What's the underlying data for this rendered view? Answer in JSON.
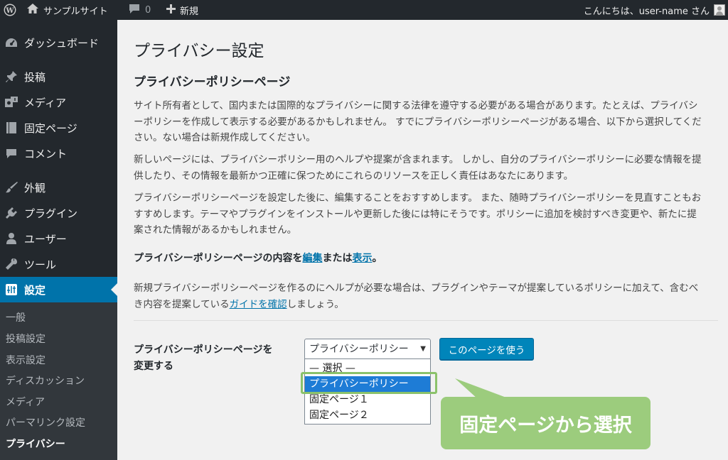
{
  "admin_bar": {
    "site_name": "サンプルサイト",
    "comment_count": "0",
    "new_label": "新規",
    "greeting": "こんにちは、user-name さん"
  },
  "sidebar": {
    "items": [
      {
        "label": "ダッシュボード",
        "icon": "dashboard-icon"
      },
      {
        "label": "投稿",
        "icon": "pin-icon"
      },
      {
        "label": "メディア",
        "icon": "media-icon"
      },
      {
        "label": "固定ページ",
        "icon": "page-icon"
      },
      {
        "label": "コメント",
        "icon": "comment-icon"
      },
      {
        "label": "外観",
        "icon": "appearance-icon"
      },
      {
        "label": "プラグイン",
        "icon": "plugin-icon"
      },
      {
        "label": "ユーザー",
        "icon": "user-icon"
      },
      {
        "label": "ツール",
        "icon": "wrench-icon"
      },
      {
        "label": "設定",
        "icon": "settings-icon"
      }
    ],
    "submenu": [
      "一般",
      "投稿設定",
      "表示設定",
      "ディスカッション",
      "メディア",
      "パーマリンク設定",
      "プライバシー"
    ]
  },
  "main": {
    "page_title": "プライバシー設定",
    "section_title": "プライバシーポリシーページ",
    "para1": [
      "サイト所有者として、国内または国際的なプライバシーに関する法律を遵守する必要がある場合があります。たとえば、プライバシ",
      "ーポリシーを作成して表示する必要があるかもしれません。 すでにプライバシーポリシーページがある場合、以下から選択してくだ",
      "さい。ない場合は新規作成してください。"
    ],
    "para2": [
      "新しいページには、プライバシーポリシー用のヘルプや提案が含まれます。 しかし、自分のプライバシーポリシーに必要な情報を提",
      "供したり、その情報を最新かつ正確に保つためにこれらのリソースを正しく責任はあなたにあります。"
    ],
    "para3": [
      "プライバシーポリシーページを設定した後に、編集することをおすすめします。 また、随時プライバシーポリシーを見直すこともお",
      "すすめします。テーマやプラグインをインストールや更新した後には特にそうです。ポリシーに追加を検討すべき変更や、新たに提",
      "案された情報があるかもしれません。"
    ],
    "edit_line": {
      "prefix": "プライバシーポリシーページの内容を",
      "edit_link": "編集",
      "middle": "または",
      "view_link": "表示",
      "suffix": "。"
    },
    "para4": {
      "line1": "新規プライバシーポリシーページを作るのにヘルプが必要な場合は、プラグインやテーマが提案しているポリシーに加えて、含むべ",
      "line2_prefix": "き内容を提案している",
      "guide_link": "ガイドを確認",
      "line2_suffix": "しましょう。"
    },
    "change_label": [
      "プライバシーポリシーページを",
      "変更する"
    ],
    "select_value": "プライバシーポリシー",
    "dropdown_options": [
      "— 選択 —",
      "プライバシーポリシー",
      "固定ページ１",
      "固定ページ２"
    ],
    "use_button": "このページを使う",
    "callout": "固定ページから選択"
  },
  "colors": {
    "admin_dark": "#23282d",
    "accent_blue": "#0073aa",
    "button_blue": "#0085ba",
    "highlight_green": "#9ccc7d"
  }
}
